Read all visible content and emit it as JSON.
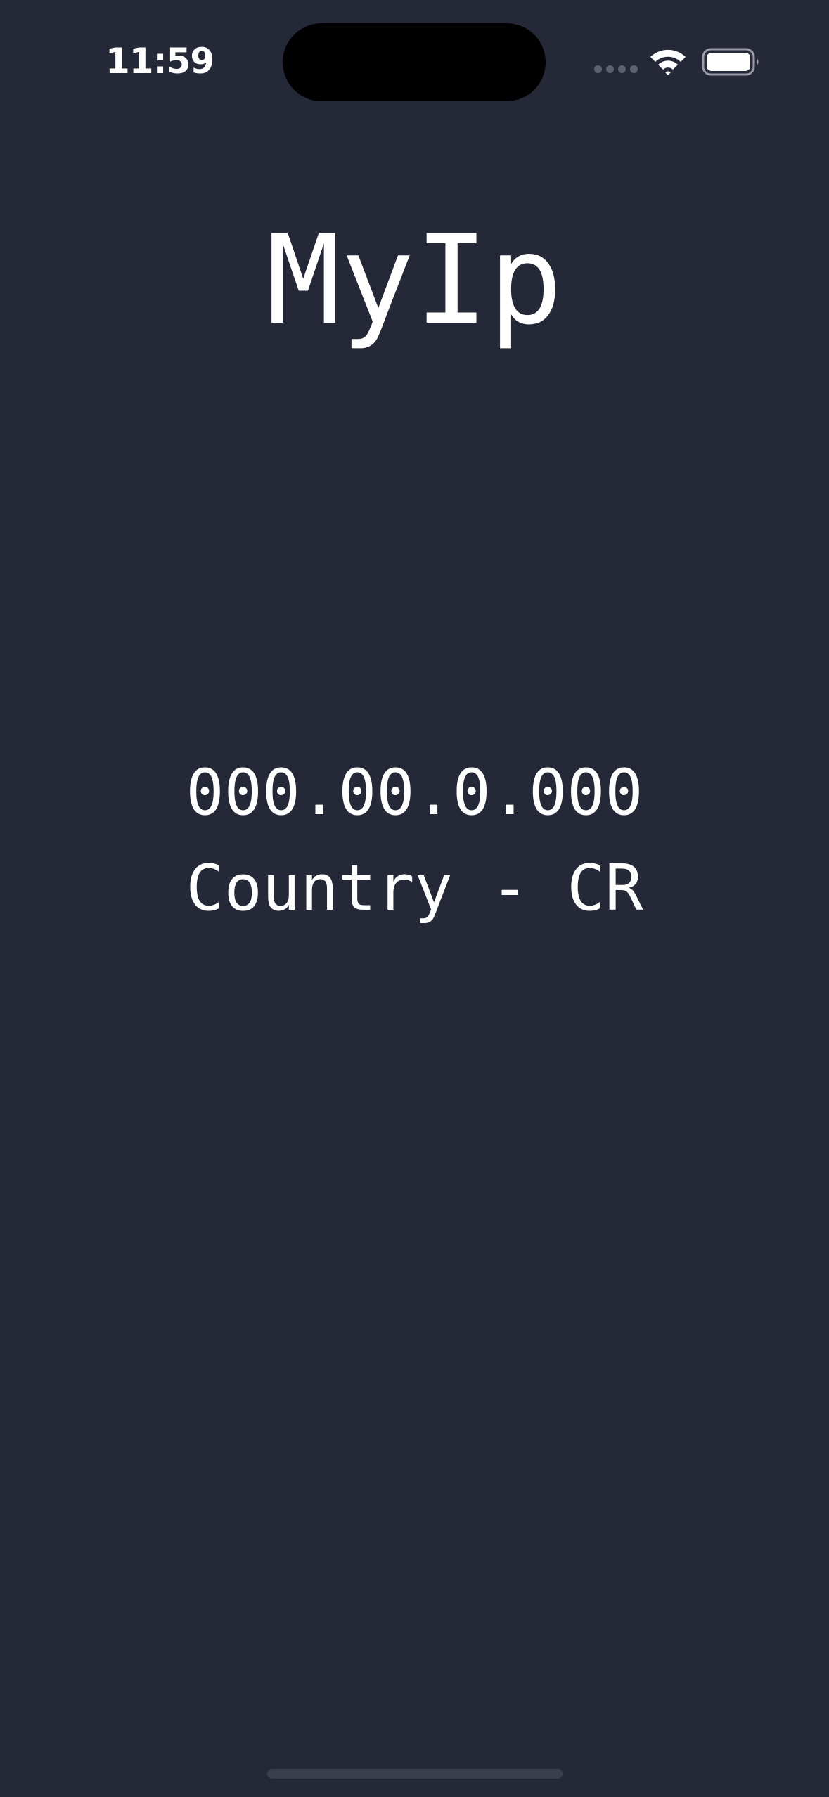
{
  "status_bar": {
    "time": "11:59"
  },
  "app": {
    "title": "MyIp",
    "ip_address": "000.00.0.000",
    "country_text": "Country - CR"
  },
  "icons": {
    "signal": "cellular-signal-icon",
    "wifi": "wifi-icon",
    "battery": "battery-icon"
  },
  "colors": {
    "background": "#252837",
    "text": "#ffffff",
    "home_indicator": "#3b3e4d"
  }
}
